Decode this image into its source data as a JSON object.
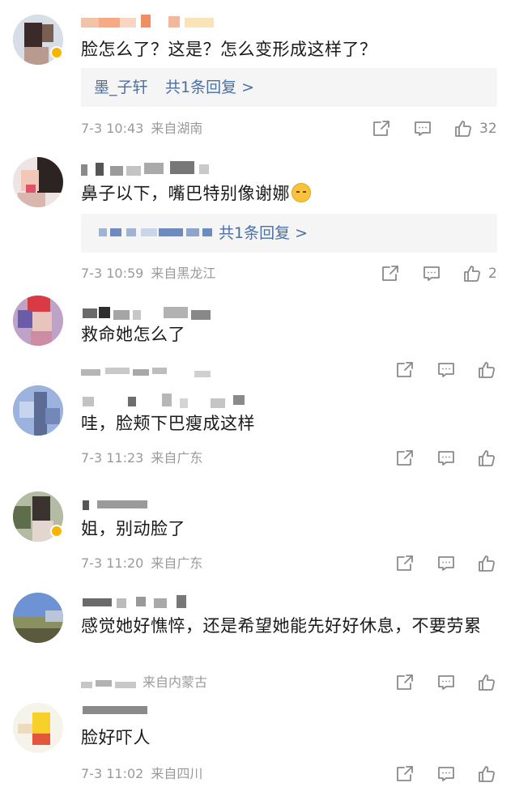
{
  "comments": [
    {
      "text": "脸怎么了？这是？怎么变形成这样了？",
      "reply": {
        "author": "墨_子轩",
        "count_label": "共1条回复 >"
      },
      "time": "7-3 10:43",
      "location": "来自湖南",
      "likes": "32"
    },
    {
      "text": "鼻子以下，嘴巴特别像谢娜",
      "reply": {
        "author": "",
        "count_label": "共1条回复 >"
      },
      "time": "7-3 10:59",
      "location": "来自黑龙江",
      "likes": "2"
    },
    {
      "text": "救命她怎么了",
      "time": "",
      "location": "",
      "likes": ""
    },
    {
      "text": "哇，脸颊下巴瘦成这样",
      "time": "7-3 11:23",
      "location": "来自广东",
      "likes": ""
    },
    {
      "text": "姐，别动脸了",
      "time": "7-3 11:20",
      "location": "来自广东",
      "likes": ""
    },
    {
      "text": "感觉她好憔悴，还是希望她能先好好休息，不要劳累",
      "time": "",
      "location": "来自内蒙古",
      "likes": ""
    },
    {
      "text": "脸好吓人",
      "time": "7-3 11:02",
      "location": "来自四川",
      "likes": ""
    }
  ],
  "icons": {
    "share": "share-icon",
    "comment": "comment-icon",
    "like": "thumbs-up-icon"
  },
  "colors": {
    "link": "#4a6fa5",
    "meta": "#9a9a9a",
    "reply_bg": "#f5f5f5",
    "verified": "#f7b500"
  }
}
